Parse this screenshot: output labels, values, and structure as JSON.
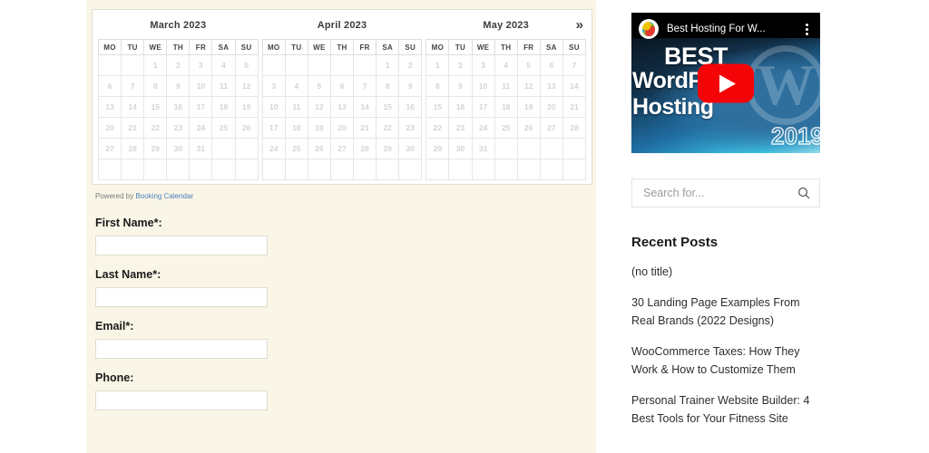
{
  "calendar": {
    "next_label": "»",
    "weekdays": [
      "MO",
      "TU",
      "WE",
      "TH",
      "FR",
      "SA",
      "SU"
    ],
    "powered_prefix": "Powered by ",
    "powered_link": "Booking Calendar",
    "months": [
      {
        "title": "March 2023",
        "weeks": [
          [
            {
              "d": "",
              "s": "empty"
            },
            {
              "d": "",
              "s": "empty"
            },
            {
              "d": "1",
              "s": "past"
            },
            {
              "d": "2",
              "s": "past"
            },
            {
              "d": "3",
              "s": "past"
            },
            {
              "d": "4",
              "s": "past"
            },
            {
              "d": "5",
              "s": "past"
            }
          ],
          [
            {
              "d": "6",
              "s": "past"
            },
            {
              "d": "7",
              "s": "past"
            },
            {
              "d": "8",
              "s": "past"
            },
            {
              "d": "9",
              "s": "past"
            },
            {
              "d": "10",
              "s": "past"
            },
            {
              "d": "11",
              "s": "past"
            },
            {
              "d": "12",
              "s": "past"
            }
          ],
          [
            {
              "d": "13",
              "s": "past"
            },
            {
              "d": "14",
              "s": "past"
            },
            {
              "d": "15",
              "s": "past"
            },
            {
              "d": "16",
              "s": "past"
            },
            {
              "d": "17",
              "s": "past"
            },
            {
              "d": "18",
              "s": "past"
            },
            {
              "d": "19",
              "s": "past"
            }
          ],
          [
            {
              "d": "20",
              "s": "past"
            },
            {
              "d": "21",
              "s": "past"
            },
            {
              "d": "22",
              "s": "past"
            },
            {
              "d": "23",
              "s": "past"
            },
            {
              "d": "24",
              "s": "free"
            },
            {
              "d": "25",
              "s": "past"
            },
            {
              "d": "26",
              "s": "pending"
            }
          ],
          [
            {
              "d": "27",
              "s": "pending"
            },
            {
              "d": "28",
              "s": "pending"
            },
            {
              "d": "29",
              "s": "free"
            },
            {
              "d": "30",
              "s": "free"
            },
            {
              "d": "31",
              "s": "free"
            },
            {
              "d": "",
              "s": "empty"
            },
            {
              "d": "",
              "s": "empty"
            }
          ],
          [
            {
              "d": "",
              "s": "empty"
            },
            {
              "d": "",
              "s": "empty"
            },
            {
              "d": "",
              "s": "empty"
            },
            {
              "d": "",
              "s": "empty"
            },
            {
              "d": "",
              "s": "empty"
            },
            {
              "d": "",
              "s": "empty"
            },
            {
              "d": "",
              "s": "empty"
            }
          ]
        ]
      },
      {
        "title": "April 2023",
        "weeks": [
          [
            {
              "d": "",
              "s": "empty"
            },
            {
              "d": "",
              "s": "empty"
            },
            {
              "d": "",
              "s": "empty"
            },
            {
              "d": "",
              "s": "empty"
            },
            {
              "d": "",
              "s": "empty"
            },
            {
              "d": "1",
              "s": "past"
            },
            {
              "d": "2",
              "s": "free"
            }
          ],
          [
            {
              "d": "3",
              "s": "free"
            },
            {
              "d": "4",
              "s": "free"
            },
            {
              "d": "5",
              "s": "free"
            },
            {
              "d": "6",
              "s": "free"
            },
            {
              "d": "7",
              "s": "free"
            },
            {
              "d": "8",
              "s": "past"
            },
            {
              "d": "9",
              "s": "free"
            }
          ],
          [
            {
              "d": "10",
              "s": "free"
            },
            {
              "d": "11",
              "s": "free"
            },
            {
              "d": "12",
              "s": "free"
            },
            {
              "d": "13",
              "s": "free"
            },
            {
              "d": "14",
              "s": "free"
            },
            {
              "d": "15",
              "s": "past"
            },
            {
              "d": "16",
              "s": "free"
            }
          ],
          [
            {
              "d": "17",
              "s": "free"
            },
            {
              "d": "18",
              "s": "free"
            },
            {
              "d": "19",
              "s": "free"
            },
            {
              "d": "20",
              "s": "free"
            },
            {
              "d": "21",
              "s": "free"
            },
            {
              "d": "22",
              "s": "past"
            },
            {
              "d": "23",
              "s": "free"
            }
          ],
          [
            {
              "d": "24",
              "s": "free"
            },
            {
              "d": "25",
              "s": "free"
            },
            {
              "d": "26",
              "s": "free"
            },
            {
              "d": "27",
              "s": "free"
            },
            {
              "d": "28",
              "s": "free"
            },
            {
              "d": "29",
              "s": "past"
            },
            {
              "d": "30",
              "s": "free"
            }
          ],
          [
            {
              "d": "",
              "s": "empty"
            },
            {
              "d": "",
              "s": "empty"
            },
            {
              "d": "",
              "s": "empty"
            },
            {
              "d": "",
              "s": "empty"
            },
            {
              "d": "",
              "s": "empty"
            },
            {
              "d": "",
              "s": "empty"
            },
            {
              "d": "",
              "s": "empty"
            }
          ]
        ]
      },
      {
        "title": "May 2023",
        "weeks": [
          [
            {
              "d": "1",
              "s": "free"
            },
            {
              "d": "2",
              "s": "free"
            },
            {
              "d": "3",
              "s": "free"
            },
            {
              "d": "4",
              "s": "free"
            },
            {
              "d": "5",
              "s": "free"
            },
            {
              "d": "6",
              "s": "past"
            },
            {
              "d": "7",
              "s": "free"
            }
          ],
          [
            {
              "d": "8",
              "s": "free"
            },
            {
              "d": "9",
              "s": "free"
            },
            {
              "d": "10",
              "s": "free"
            },
            {
              "d": "11",
              "s": "free"
            },
            {
              "d": "12",
              "s": "free"
            },
            {
              "d": "13",
              "s": "past"
            },
            {
              "d": "14",
              "s": "free"
            }
          ],
          [
            {
              "d": "15",
              "s": "free"
            },
            {
              "d": "16",
              "s": "free"
            },
            {
              "d": "17",
              "s": "free"
            },
            {
              "d": "18",
              "s": "free"
            },
            {
              "d": "19",
              "s": "free"
            },
            {
              "d": "20",
              "s": "past"
            },
            {
              "d": "21",
              "s": "free"
            }
          ],
          [
            {
              "d": "22",
              "s": "free"
            },
            {
              "d": "23",
              "s": "free"
            },
            {
              "d": "24",
              "s": "free"
            },
            {
              "d": "25",
              "s": "free"
            },
            {
              "d": "26",
              "s": "free"
            },
            {
              "d": "27",
              "s": "past"
            },
            {
              "d": "28",
              "s": "free"
            }
          ],
          [
            {
              "d": "29",
              "s": "free"
            },
            {
              "d": "30",
              "s": "free"
            },
            {
              "d": "31",
              "s": "free"
            },
            {
              "d": "",
              "s": "empty"
            },
            {
              "d": "",
              "s": "empty"
            },
            {
              "d": "",
              "s": "empty"
            },
            {
              "d": "",
              "s": "empty"
            }
          ],
          [
            {
              "d": "",
              "s": "empty"
            },
            {
              "d": "",
              "s": "empty"
            },
            {
              "d": "",
              "s": "empty"
            },
            {
              "d": "",
              "s": "empty"
            },
            {
              "d": "",
              "s": "empty"
            },
            {
              "d": "",
              "s": "empty"
            },
            {
              "d": "",
              "s": "empty"
            }
          ]
        ]
      }
    ],
    "colors": {
      "available": "#1ed61e",
      "pending": "#f6c90b",
      "background": "#faf6e7"
    }
  },
  "form": {
    "fields": [
      {
        "label": "First Name*:",
        "value": "",
        "placeholder": ""
      },
      {
        "label": "Last Name*:",
        "value": "",
        "placeholder": ""
      },
      {
        "label": "Email*:",
        "value": "",
        "placeholder": ""
      },
      {
        "label": "Phone:",
        "value": "",
        "placeholder": ""
      }
    ]
  },
  "sidebar": {
    "video": {
      "title": "Best Hosting For W...",
      "thumbnail_line1": "BEST",
      "thumbnail_line2": "WordPress",
      "thumbnail_line3": "Hosting",
      "thumbnail_year": "2019",
      "wp_mark": "W"
    },
    "search": {
      "placeholder": "Search for...",
      "value": ""
    },
    "recent_posts": {
      "title": "Recent Posts",
      "items": [
        "(no title)",
        "30 Landing Page Examples From Real Brands (2022 Designs)",
        "WooCommerce Taxes: How They Work & How to Customize Them",
        "Personal Trainer Website Builder: 4 Best Tools for Your Fitness Site"
      ]
    }
  }
}
